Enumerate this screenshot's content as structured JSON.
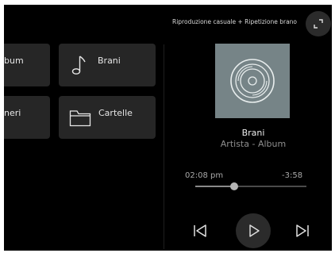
{
  "library": {
    "tiles": [
      {
        "label": "bum"
      },
      {
        "label": "Brani",
        "icon": "music-note-icon"
      },
      {
        "label": "neri"
      },
      {
        "label": "Cartelle",
        "icon": "folder-icon"
      }
    ]
  },
  "player": {
    "mode_label": "Riproduzione casuale + Ripetizione brano",
    "track_title": "Brani",
    "track_subtitle": "Artista - Album",
    "time_elapsed": "02:08 pm",
    "time_remaining": "-3:58",
    "progress_fraction": 0.35,
    "controls": {
      "previous_icon": "skip-previous-icon",
      "play_icon": "play-icon",
      "next_icon": "skip-next-icon"
    },
    "album_art_icon": "vinyl-record-icon"
  },
  "colors": {
    "background": "#000000",
    "tile": "#262626",
    "album_art": "#768487"
  }
}
